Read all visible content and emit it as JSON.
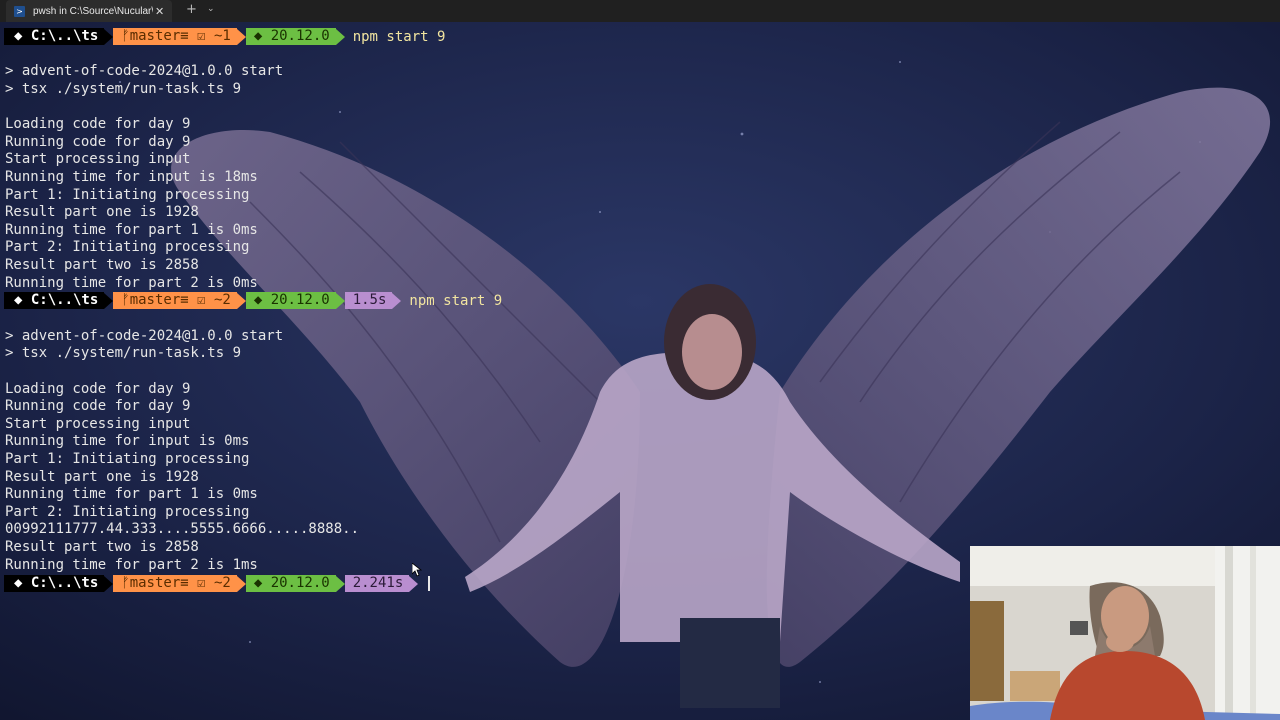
{
  "window": {
    "tab_title": "pwsh in C:\\Source\\Nucular\\A",
    "tab_icon": "powershell-icon",
    "close_glyph": "✕",
    "new_tab_glyph": "+",
    "dropdown_glyph": "⌄"
  },
  "colors": {
    "path_bg": "#000000",
    "git_bg": "#ff9248",
    "node_bg": "#6cbf43",
    "time_bg": "#b98ed0",
    "command_text": "#f2e5a0"
  },
  "prompts": [
    {
      "path": "◆ C:\\..\\ts",
      "git": "ᚠmaster≡ ☑ ~1",
      "node": "◆ 20.12.0",
      "time": "",
      "command": "npm start 9"
    },
    {
      "path": "◆ C:\\..\\ts",
      "git": "ᚠmaster≡ ☑ ~2",
      "node": "◆ 20.12.0",
      "time": "1.5s",
      "command": "npm start 9"
    },
    {
      "path": "◆ C:\\..\\ts",
      "git": "ᚠmaster≡ ☑ ~2",
      "node": "◆ 20.12.0",
      "time": "2.241s",
      "command": ""
    }
  ],
  "run1": [
    "> advent-of-code-2024@1.0.0 start",
    "> tsx ./system/run-task.ts 9",
    "",
    "Loading code for day 9",
    "Running code for day 9",
    "Start processing input",
    "Running time for input is 18ms",
    "Part 1: Initiating processing",
    "Result part one is 1928",
    "Running time for part 1 is 0ms",
    "Part 2: Initiating processing",
    "Result part two is 2858",
    "Running time for part 2 is 0ms"
  ],
  "run2": [
    "> advent-of-code-2024@1.0.0 start",
    "> tsx ./system/run-task.ts 9",
    "",
    "Loading code for day 9",
    "Running code for day 9",
    "Start processing input",
    "Running time for input is 0ms",
    "Part 1: Initiating processing",
    "Result part one is 1928",
    "Running time for part 1 is 0ms",
    "Part 2: Initiating processing",
    "00992111777.44.333....5555.6666.....8888..",
    "Result part two is 2858",
    "Running time for part 2 is 1ms"
  ]
}
